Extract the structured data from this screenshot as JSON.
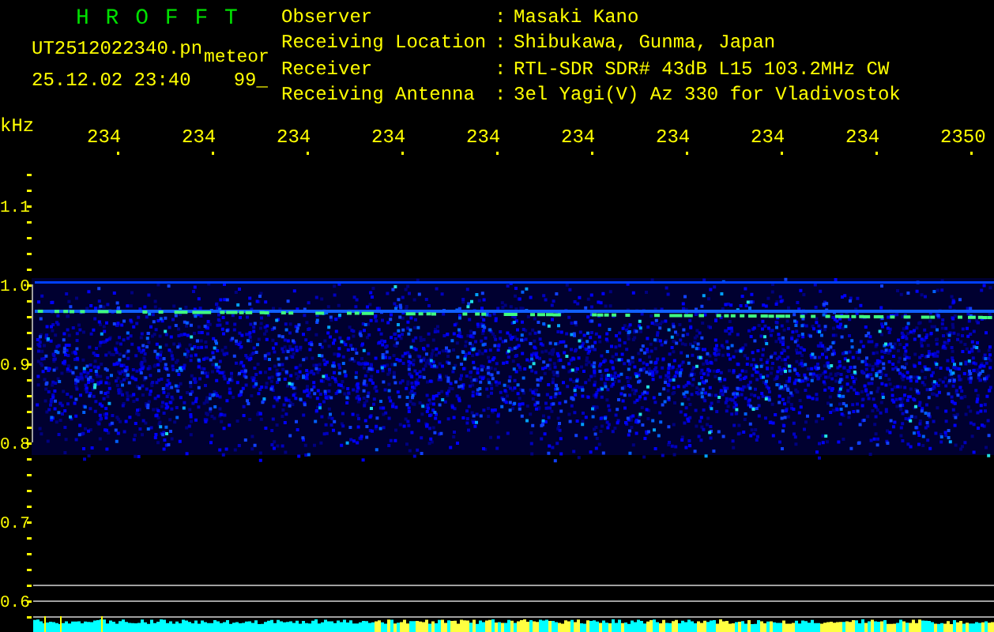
{
  "app": {
    "title": "H R O F F T",
    "file_name": "UT2512022340.pn",
    "mode": "meteor",
    "datetime": "25.12.02 23:40",
    "reading": "99_"
  },
  "station_info": [
    {
      "label": "Observer",
      "separator": ":",
      "value": "Masaki Kano"
    },
    {
      "label": "Receiving Location",
      "separator": ":",
      "value": "Shibukawa, Gunma, Japan"
    },
    {
      "label": "Receiver",
      "separator": ":",
      "value": "RTL-SDR SDR# 43dB L15 103.2MHz CW"
    },
    {
      "label": "Receiving Antenna",
      "separator": ":",
      "value": "3el Yagi(V) Az 330 for Vladivostok"
    }
  ],
  "frequency_axis": {
    "unit": "kHz",
    "labels": [
      "1.1",
      "1.0",
      "0.9",
      "0.8",
      "0.7",
      "0.6"
    ]
  },
  "time_axis": {
    "labels": [
      "234",
      "234",
      "234",
      "234",
      "234",
      "234",
      "234",
      "234",
      "234",
      "2350"
    ]
  }
}
